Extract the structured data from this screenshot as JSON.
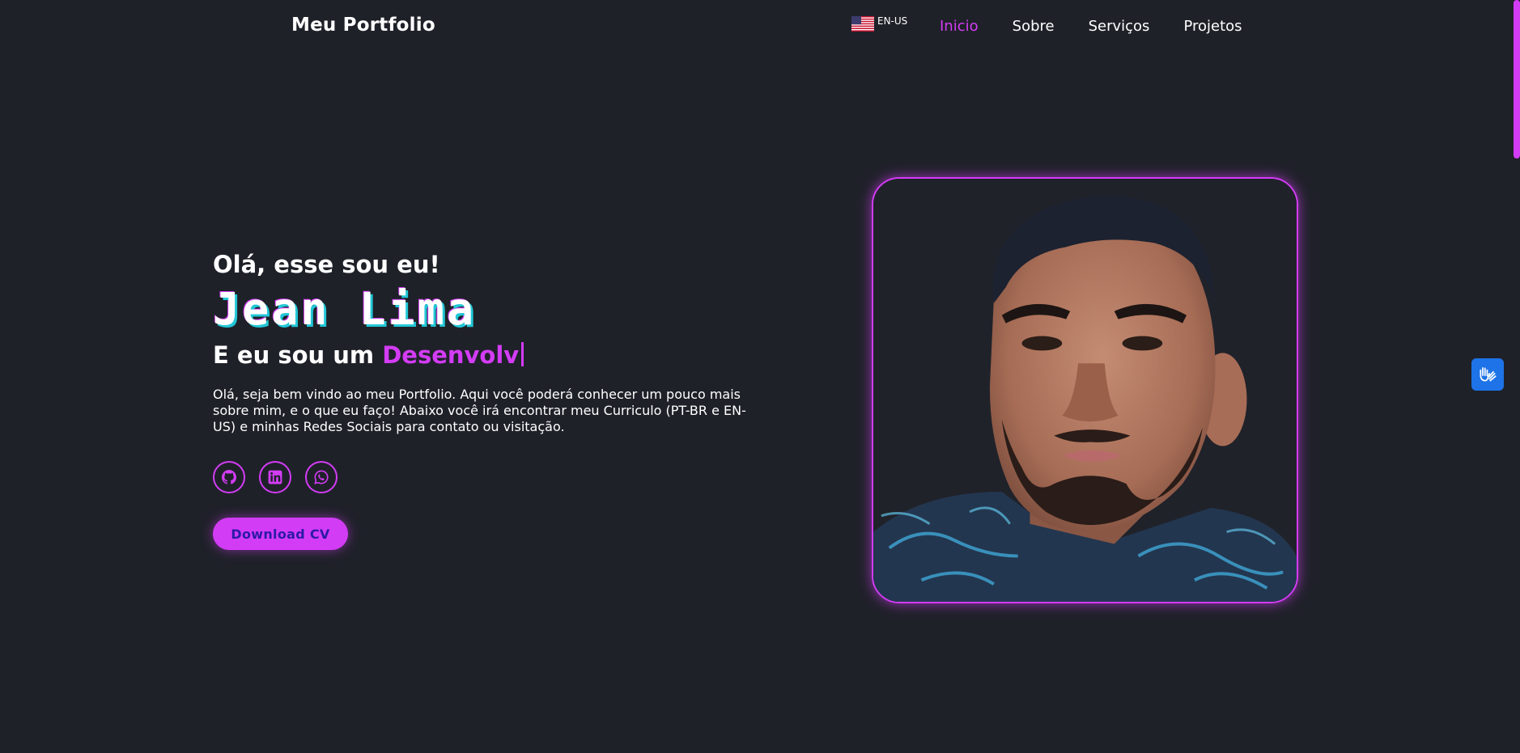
{
  "header": {
    "logo": "Meu Portfolio",
    "language": {
      "label": "EN-US",
      "flag_icon": "us-flag-icon"
    },
    "nav": [
      {
        "label": "Inicio",
        "active": true
      },
      {
        "label": "Sobre",
        "active": false
      },
      {
        "label": "Serviços",
        "active": false
      },
      {
        "label": "Projetos",
        "active": false
      }
    ]
  },
  "hero": {
    "greeting": "Olá, esse sou eu!",
    "name": "Jean Lima",
    "role_prefix": "E eu sou um ",
    "role_typed": "Desenvolv",
    "intro": "Olá, seja bem vindo ao meu Portfolio. Aqui você poderá conhecer um pouco mais sobre mim, e o que eu faço! Abaixo você irá encontrar meu Curriculo (PT-BR e EN-US) e minhas Redes Sociais para contato ou visitação.",
    "socials": [
      {
        "name": "github",
        "icon": "github-icon"
      },
      {
        "name": "linkedin",
        "icon": "linkedin-icon"
      },
      {
        "name": "whatsapp",
        "icon": "whatsapp-icon"
      }
    ],
    "cv_button": "Download CV"
  },
  "colors": {
    "background": "#1f2129",
    "accent": "#d33cf5",
    "name_shadow": "#22c7d6",
    "cv_text": "#2b1aa8",
    "a11y": "#1e73e8"
  },
  "accessibility_widget": {
    "icon": "sign-language-hands-icon"
  }
}
